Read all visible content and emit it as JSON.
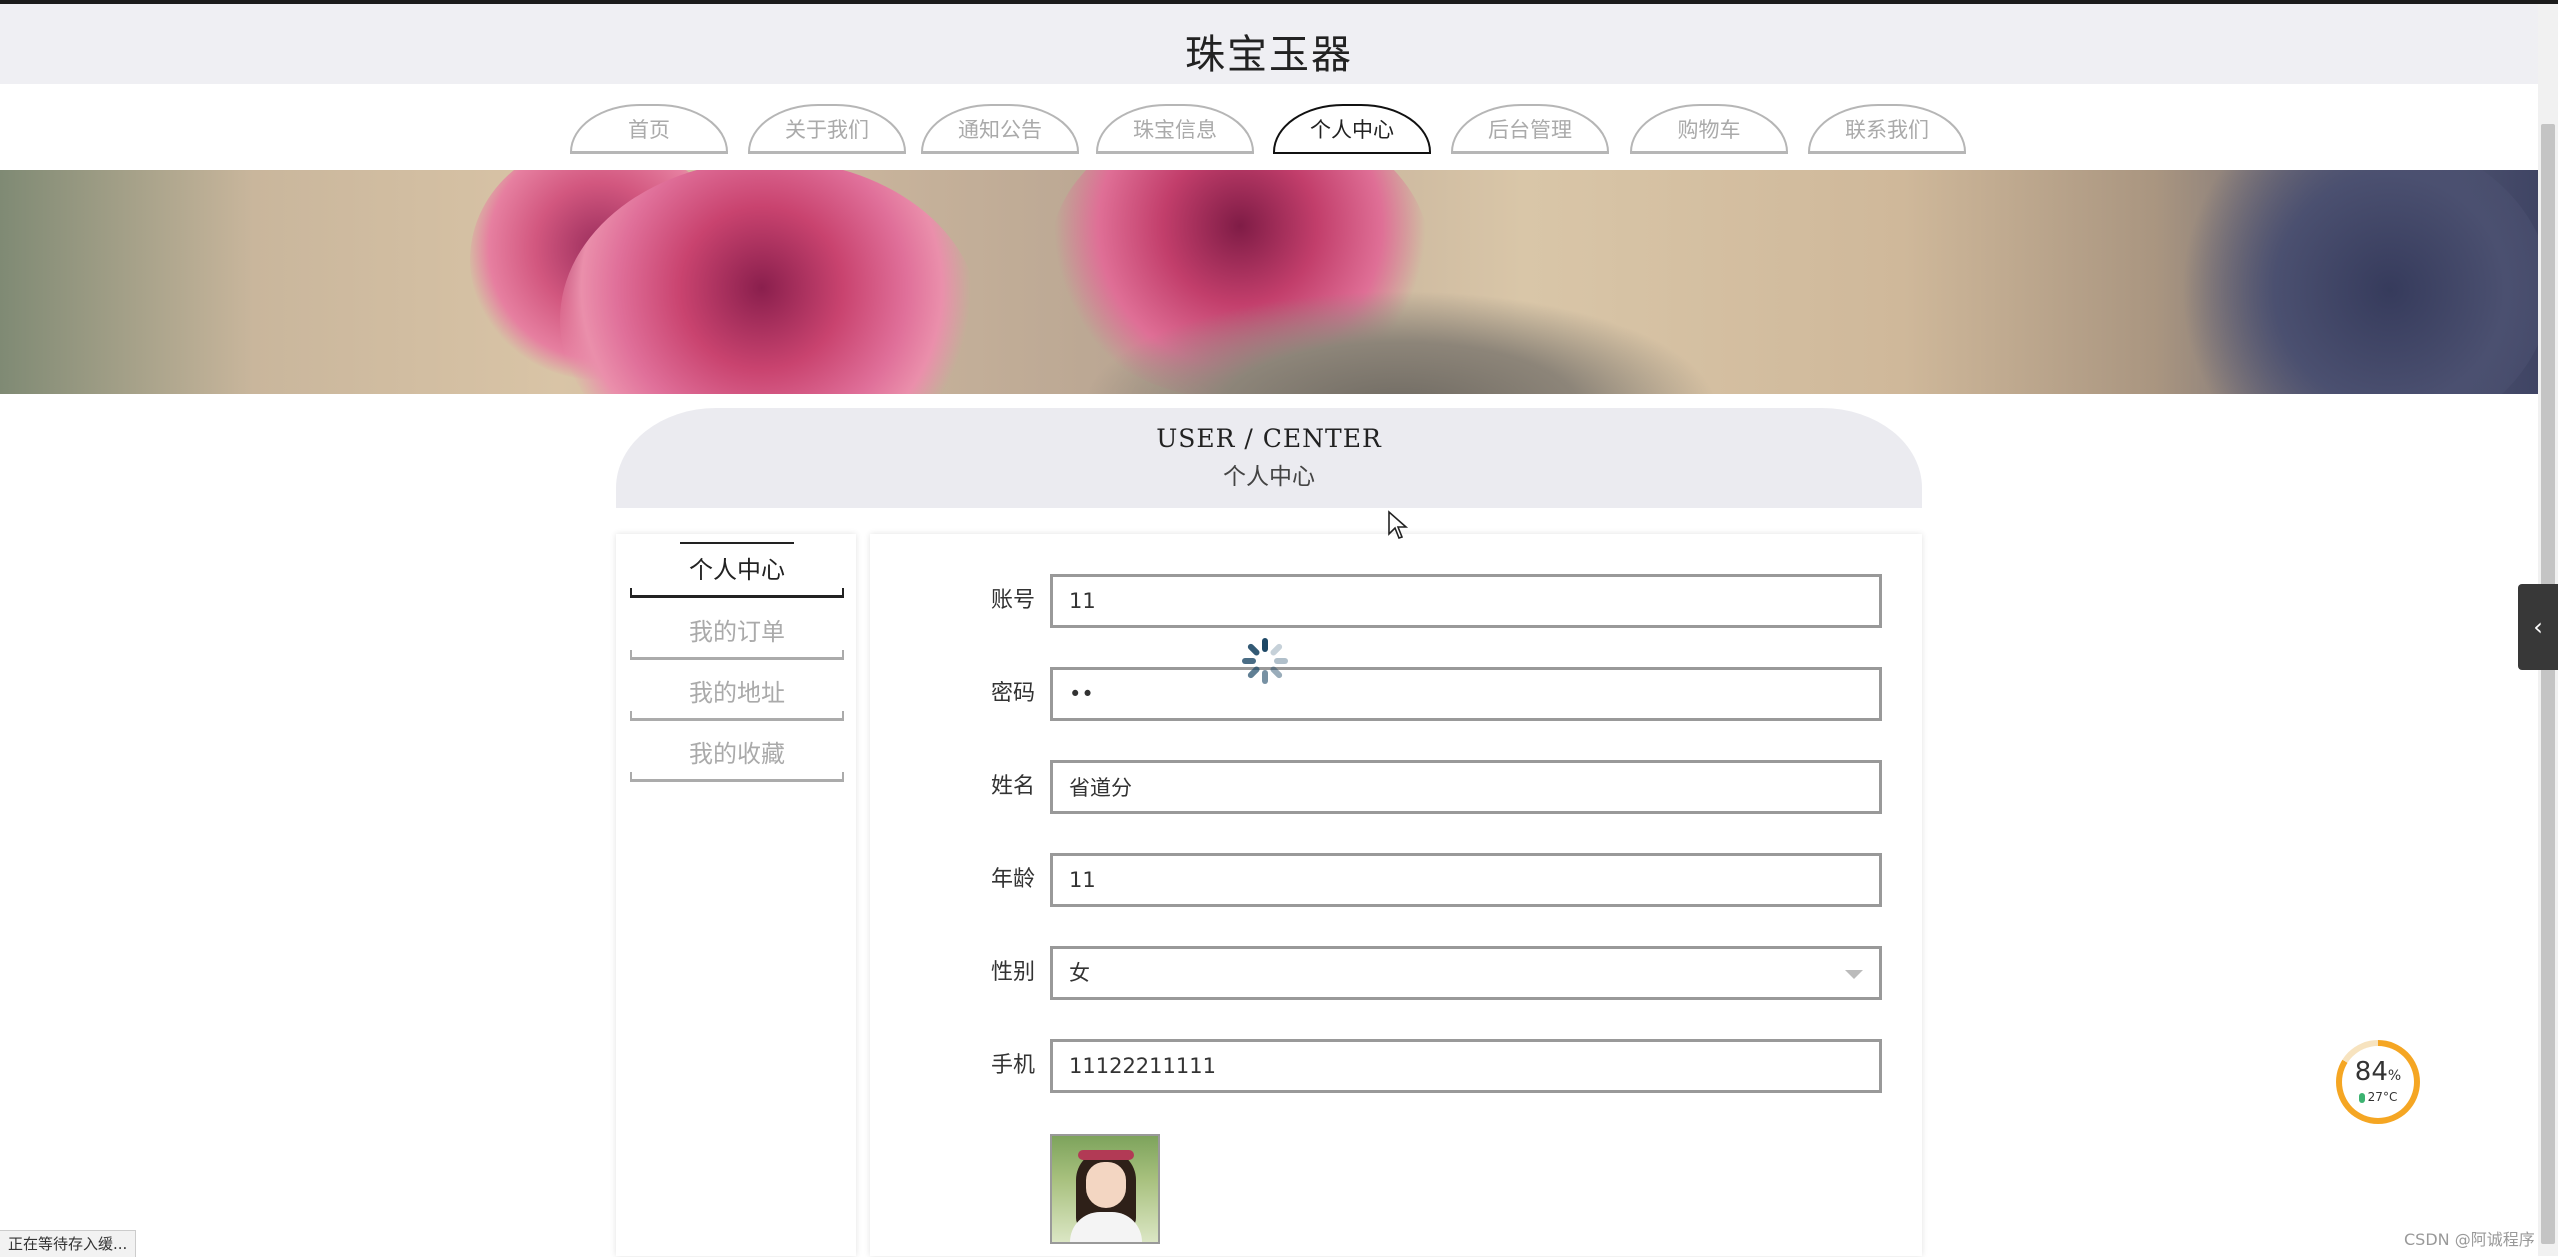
{
  "site": {
    "title": "珠宝玉器"
  },
  "nav": {
    "items": [
      "首页",
      "关于我们",
      "通知公告",
      "珠宝信息",
      "个人中心",
      "后台管理",
      "购物车",
      "联系我们"
    ],
    "active": "个人中心"
  },
  "section": {
    "title_en": "USER / CENTER",
    "title_cn": "个人中心"
  },
  "sidebar": {
    "items": [
      "个人中心",
      "我的订单",
      "我的地址",
      "我的收藏"
    ],
    "active": "个人中心"
  },
  "form": {
    "account": {
      "label": "账号",
      "value": "11"
    },
    "password": {
      "label": "密码",
      "value": "••"
    },
    "name": {
      "label": "姓名",
      "value": "省道分"
    },
    "age": {
      "label": "年龄",
      "value": "11"
    },
    "gender": {
      "label": "性别",
      "value": "女"
    },
    "phone": {
      "label": "手机",
      "value": "11122211111"
    }
  },
  "widget": {
    "percent": "84",
    "percent_unit": "%",
    "temperature": "27°C",
    "level": 0.84
  },
  "status_bar": {
    "text": "正在等待存入缓..."
  },
  "watermark": {
    "text": "CSDN @阿诚程序"
  },
  "colors": {
    "accent": "#111111",
    "header_bg": "#efeff3",
    "inactive_text": "#aaaaaa",
    "widget_ring": "#f5a623"
  }
}
